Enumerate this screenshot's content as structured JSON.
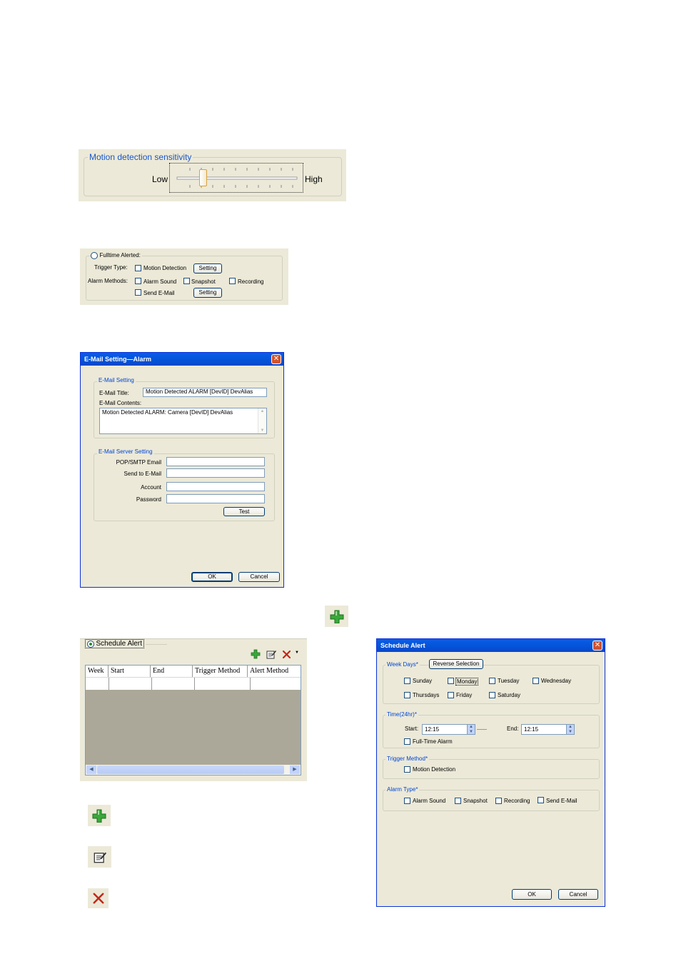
{
  "sensitivity": {
    "title": "Motion detection sensitivity",
    "low_label": "Low",
    "high_label": "High",
    "value_fraction": 0.2
  },
  "fulltime": {
    "radio_label": "Fulltime Alerted:",
    "trigger_type_label": "Trigger Type:",
    "motion_detection": "Motion Detection",
    "setting_button": "Setting",
    "alarm_methods_label": "Alarm Methods:",
    "alarm_sound": "Alarm Sound",
    "snapshot": "Snapshot",
    "recording": "Recording",
    "send_email": "Send E-Mail",
    "setting_button_2": "Setting"
  },
  "email_dialog": {
    "title": "E-Mail Setting—Alarm",
    "email_setting_group": "E-Mail Setting",
    "email_title_label": "E-Mail Title:",
    "email_title_value": "Motion Detected ALARM [DevID] DevAlias",
    "email_contents_label": "E-Mail Contents:",
    "email_contents_value": "Motion Detected ALARM: Camera [DevID] DevAlias",
    "server_group": "E-Mail Server Setting",
    "pop_smtp_label": "POP/SMTP Email",
    "send_to_label": "Send to E-Mail",
    "account_label": "Account",
    "password_label": "Password",
    "test_button": "Test",
    "ok_button": "OK",
    "cancel_button": "Cancel"
  },
  "schedule_panel": {
    "radio_label": "Schedule Alert",
    "columns": [
      "Week",
      "Start",
      "End",
      "Trigger Method",
      "Alert Method"
    ]
  },
  "schedule_dialog": {
    "title": "Schedule Alert",
    "week_days_group": "Week Days*",
    "reverse_button": "Reverse Selection",
    "days": [
      "Sunday",
      "Monday",
      "Tuesday",
      "Wednesday",
      "Thursdays",
      "Friday",
      "Saturday"
    ],
    "time_group": "Time(24hr)*",
    "start_label": "Start:",
    "start_value": "12:15",
    "end_label": "End:",
    "end_value": "12:15",
    "fulltime_alarm": "Full-Time Alarm",
    "trigger_group": "Trigger Method*",
    "motion_detection": "Motion Detection",
    "alarm_type_group": "Alarm Type*",
    "alarm_sound": "Alarm Sound",
    "snapshot": "Snapshot",
    "recording": "Recording",
    "send_email": "Send E-Mail",
    "ok_button": "OK",
    "cancel_button": "Cancel"
  },
  "icons": {
    "add": "add-icon",
    "edit": "edit-icon",
    "delete": "delete-icon"
  },
  "colors": {
    "xp_face": "#ece9d8",
    "xp_title": "#0453d8",
    "group_title": "#0046d5",
    "add_green": "#3aa83a",
    "delete_red": "#c0281c"
  }
}
